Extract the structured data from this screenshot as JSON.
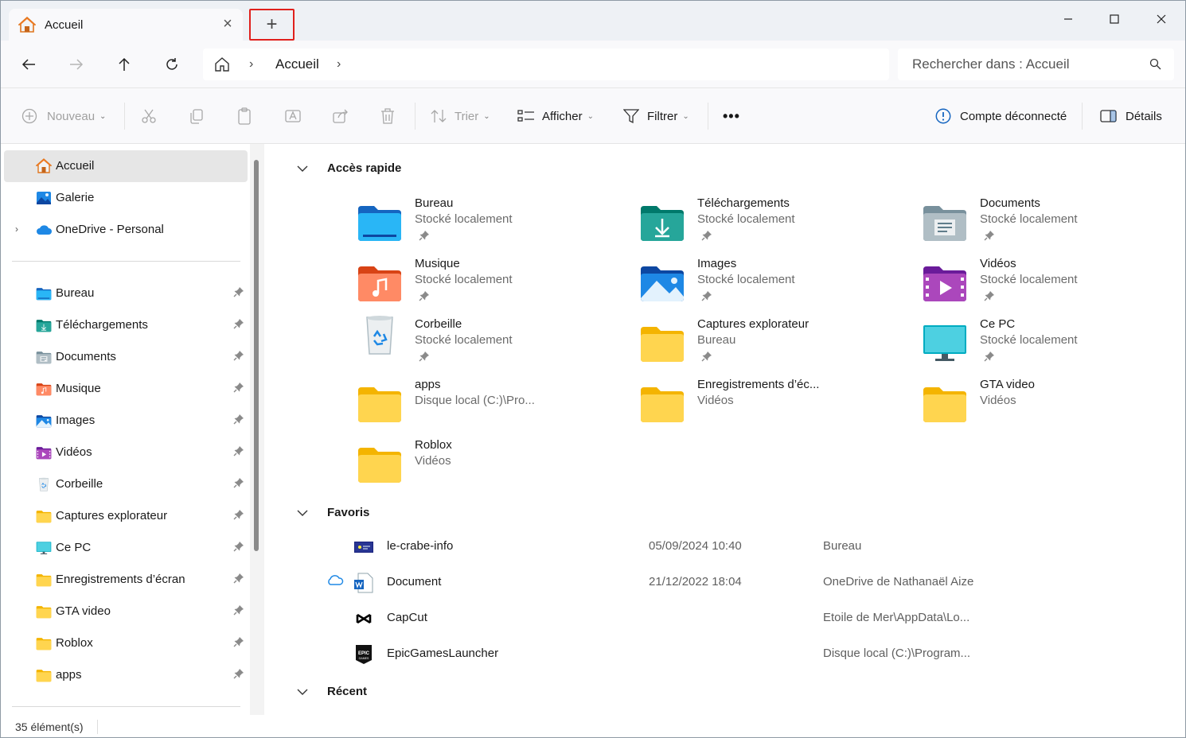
{
  "window": {
    "tab_title": "Accueil",
    "new_tab_symbol": "+"
  },
  "navigation": {
    "breadcrumb_current": "Accueil",
    "search_placeholder": "Rechercher dans : Accueil"
  },
  "commands": {
    "new_label": "Nouveau",
    "sort_label": "Trier",
    "view_label": "Afficher",
    "filter_label": "Filtrer",
    "more_label": "•••",
    "account_label": "Compte déconnecté",
    "details_label": "Détails"
  },
  "sidebar": {
    "top_items": [
      {
        "label": "Accueil",
        "icon": "home-icon"
      },
      {
        "label": "Galerie",
        "icon": "gallery-icon"
      },
      {
        "label": "OneDrive - Personal",
        "icon": "onedrive-icon"
      }
    ],
    "pinned_items": [
      {
        "label": "Bureau",
        "icon": "desktop-icon"
      },
      {
        "label": "Téléchargements",
        "icon": "download-icon"
      },
      {
        "label": "Documents",
        "icon": "documents-icon"
      },
      {
        "label": "Musique",
        "icon": "music-icon"
      },
      {
        "label": "Images",
        "icon": "pictures-icon"
      },
      {
        "label": "Vidéos",
        "icon": "videos-icon"
      },
      {
        "label": "Corbeille",
        "icon": "recycle-bin-icon"
      },
      {
        "label": "Captures explorateur",
        "icon": "folder-icon"
      },
      {
        "label": "Ce PC",
        "icon": "pc-icon"
      },
      {
        "label": "Enregistrements d’écran",
        "icon": "folder-icon"
      },
      {
        "label": "GTA video",
        "icon": "folder-icon"
      },
      {
        "label": "Roblox",
        "icon": "folder-icon"
      },
      {
        "label": "apps",
        "icon": "folder-icon"
      }
    ]
  },
  "quick_access": {
    "heading": "Accès rapide",
    "items": [
      {
        "name": "Bureau",
        "location": "Stocké localement",
        "icon": "desktop-icon"
      },
      {
        "name": "Téléchargements",
        "location": "Stocké localement",
        "icon": "download-icon"
      },
      {
        "name": "Documents",
        "location": "Stocké localement",
        "icon": "documents-icon"
      },
      {
        "name": "Musique",
        "location": "Stocké localement",
        "icon": "music-icon"
      },
      {
        "name": "Images",
        "location": "Stocké localement",
        "icon": "pictures-icon"
      },
      {
        "name": "Vidéos",
        "location": "Stocké localement",
        "icon": "videos-icon"
      },
      {
        "name": "Corbeille",
        "location": "Stocké localement",
        "icon": "recycle-bin-icon"
      },
      {
        "name": "Captures explorateur",
        "location": "Bureau",
        "icon": "folder-icon"
      },
      {
        "name": "Ce PC",
        "location": "Stocké localement",
        "icon": "pc-icon"
      },
      {
        "name": "apps",
        "location": "Disque local (C:)\\Pro...",
        "icon": "folder-icon"
      },
      {
        "name": "Enregistrements d’éc...",
        "location": "Vidéos",
        "icon": "folder-icon"
      },
      {
        "name": "GTA video",
        "location": "Vidéos",
        "icon": "folder-icon"
      },
      {
        "name": "Roblox",
        "location": "Vidéos",
        "icon": "folder-icon"
      }
    ]
  },
  "favorites": {
    "heading": "Favoris",
    "rows": [
      {
        "name": "le-crabe-info",
        "date": "05/09/2024 10:40",
        "location": "Bureau",
        "icon": "shortcut-icon"
      },
      {
        "name": "Document",
        "date": "21/12/2022 18:04",
        "location": "OneDrive de Nathanaël Aize",
        "icon": "word-doc-icon"
      },
      {
        "name": "CapCut",
        "date": "",
        "location": "Etoile de Mer\\AppData\\Lo...",
        "icon": "capcut-icon"
      },
      {
        "name": "EpicGamesLauncher",
        "date": "",
        "location": "Disque local (C:)\\Program...",
        "icon": "epic-games-icon"
      }
    ]
  },
  "recent": {
    "heading": "Récent"
  },
  "status": {
    "item_count": "35 élément(s)"
  }
}
